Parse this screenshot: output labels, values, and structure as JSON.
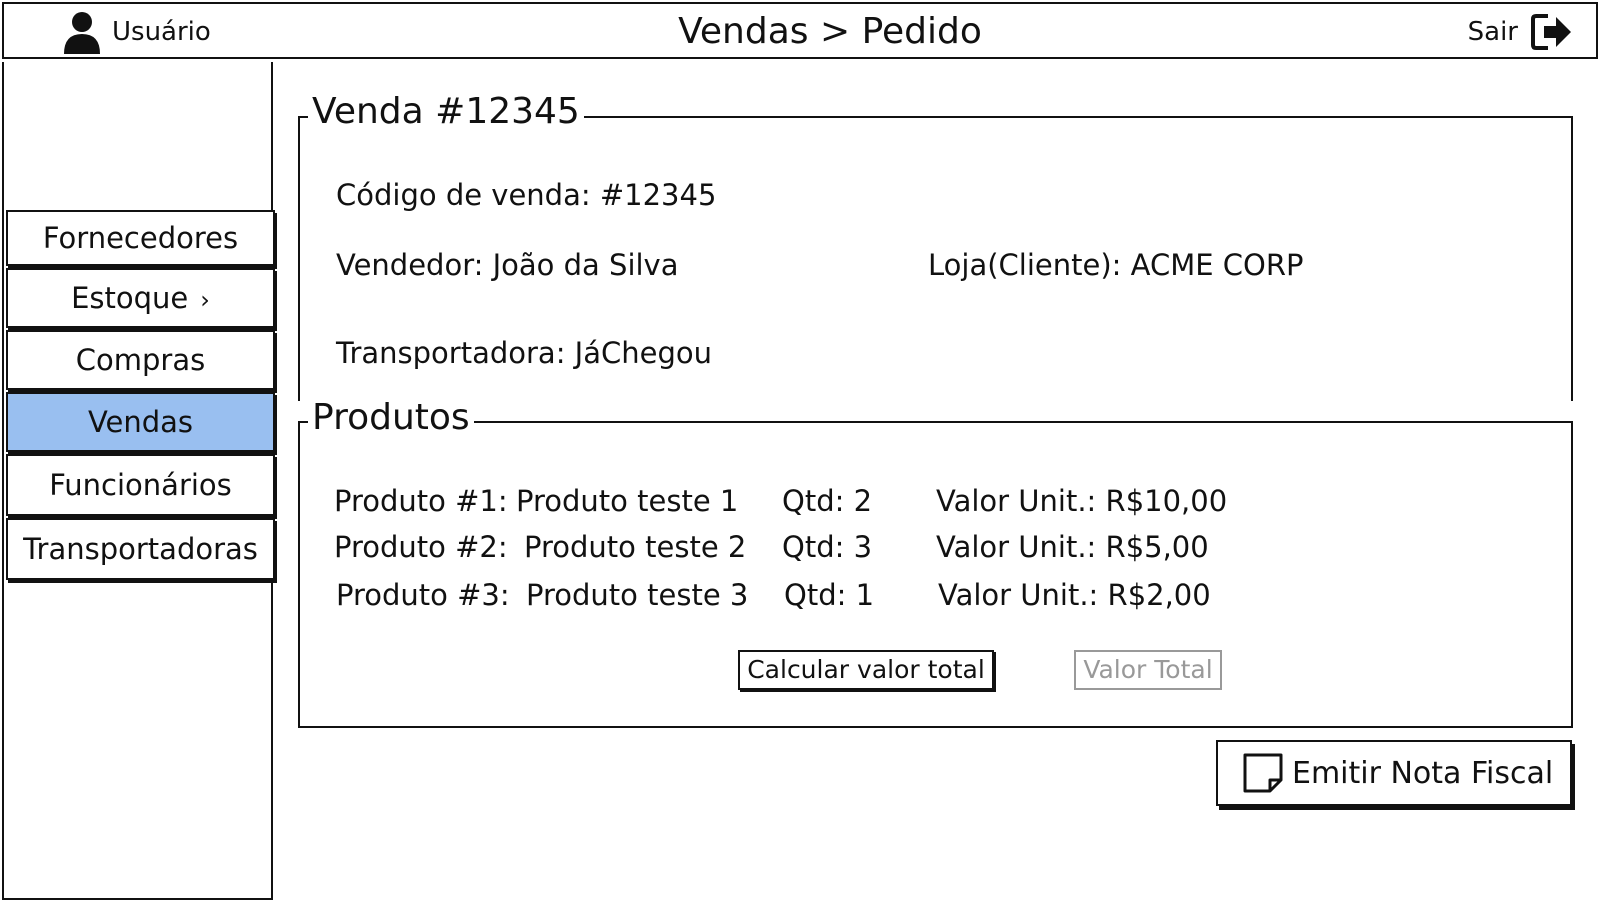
{
  "header": {
    "user_label": "Usuário",
    "title": "Vendas > Pedido",
    "logout_label": "Sair"
  },
  "sidebar": {
    "items": [
      {
        "label": "Fornecedores",
        "active": false
      },
      {
        "label": "Estoque",
        "active": false,
        "has_submenu": true
      },
      {
        "label": "Compras",
        "active": false
      },
      {
        "label": "Vendas",
        "active": true
      },
      {
        "label": "Funcionários",
        "active": false
      },
      {
        "label": "Transportadoras",
        "active": false
      }
    ],
    "active_color": "#99bff0"
  },
  "sale": {
    "legend": "Venda #12345",
    "code": "Código de venda: #12345",
    "seller": "Vendedor: João da Silva",
    "store": "Loja(Cliente): ACME CORP",
    "carrier": "Transportadora: JáChegou"
  },
  "products": {
    "legend": "Produtos",
    "rows": [
      {
        "label": "Produto #1:",
        "name": "Produto teste 1",
        "qty": "Qtd: 2",
        "price": "Valor Unit.: R$10,00"
      },
      {
        "label": "Produto #2:",
        "name": "Produto teste 2",
        "qty": "Qtd: 3",
        "price": "Valor Unit.: R$5,00"
      },
      {
        "label": "Produto #3:",
        "name": "Produto teste 3",
        "qty": "Qtd: 1",
        "price": "Valor Unit.: R$2,00"
      }
    ],
    "calc_button": "Calcular valor total",
    "total_placeholder": "Valor Total"
  },
  "actions": {
    "invoice_button": "Emitir Nota Fiscal"
  },
  "icons": {
    "user": "user-icon",
    "logout": "logout-icon",
    "document": "document-icon"
  }
}
